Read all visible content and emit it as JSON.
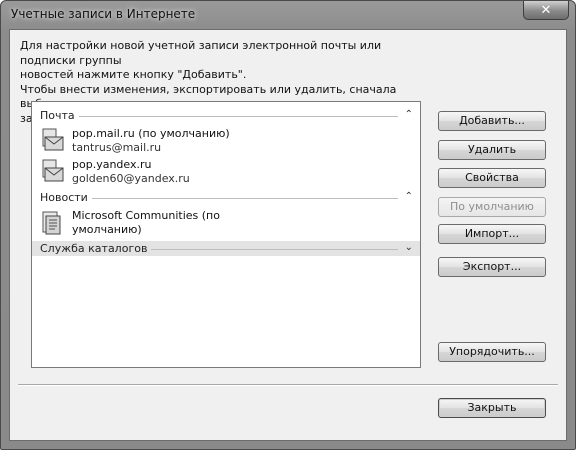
{
  "window": {
    "title": "Учетные записи в Интернете",
    "close_symbol": "✕"
  },
  "description": "Для настройки новой учетной записи электронной почты или подписки группы\nновостей нажмите кнопку \"Добавить\".\nЧтобы внести изменения, экспортировать или удалить, сначала выберите учетную\nзапись или подписку.",
  "list": {
    "groups": [
      {
        "label": "Почта",
        "chevron": "⌃"
      },
      {
        "label": "Новости",
        "chevron": "⌃"
      },
      {
        "label": "Служба каталогов",
        "chevron": "⌄"
      }
    ],
    "mail_accounts": [
      {
        "name": "pop.mail.ru (по умолчанию)",
        "email": "tantrus@mail.ru",
        "icon": "mail-account-icon"
      },
      {
        "name": "pop.yandex.ru",
        "email": "golden60@yandex.ru",
        "icon": "mail-account-icon"
      }
    ],
    "news_accounts": [
      {
        "name_line1": "Microsoft Communities (по",
        "name_line2": "умолчанию)",
        "icon": "news-account-icon"
      }
    ]
  },
  "buttons": {
    "add": "Добавить...",
    "remove": "Удалить",
    "properties": "Свойства",
    "set_default": "По умолчанию",
    "import": "Импорт...",
    "export": "Экспорт...",
    "order": "Упорядочить...",
    "close": "Закрыть"
  }
}
